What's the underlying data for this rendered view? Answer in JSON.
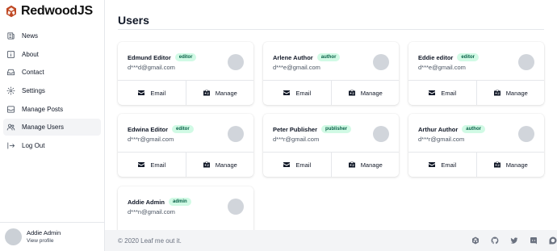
{
  "brand": {
    "name": "RedwoodJS",
    "accent": "#bf4722"
  },
  "sidebar": {
    "items": [
      {
        "label": "News",
        "icon": "newspaper-icon"
      },
      {
        "label": "About",
        "icon": "info-icon"
      },
      {
        "label": "Contact",
        "icon": "inbox-icon"
      },
      {
        "label": "Settings",
        "icon": "gear-icon"
      },
      {
        "label": "Manage Posts",
        "icon": "archive-icon"
      },
      {
        "label": "Manage Users",
        "icon": "users-icon",
        "active": true
      },
      {
        "label": "Log Out",
        "icon": "logout-icon"
      }
    ],
    "profile": {
      "name": "Addie Admin",
      "link": "View profile"
    }
  },
  "page": {
    "title": "Users"
  },
  "users": [
    {
      "name": "Edmund Editor",
      "role": "editor",
      "email": "d***d@gmail.com"
    },
    {
      "name": "Arlene Author",
      "role": "author",
      "email": "d***e@gmail.com"
    },
    {
      "name": "Eddie editor",
      "role": "editor",
      "email": "d***e@gmail.com"
    },
    {
      "name": "Edwina Editor",
      "role": "editor",
      "email": "d***r@gmail.com"
    },
    {
      "name": "Peter Publisher",
      "role": "publisher",
      "email": "d***r@gmail.com"
    },
    {
      "name": "Arthur Author",
      "role": "author",
      "email": "d***r@gmail.com"
    },
    {
      "name": "Addie Admin",
      "role": "admin",
      "email": "d***n@gmail.com"
    }
  ],
  "card_actions": {
    "email": "Email",
    "manage": "Manage"
  },
  "footer": {
    "copyright": "© 2020 Leaf me out it.",
    "social_icons": [
      "redwood-icon",
      "github-icon",
      "twitter-icon",
      "discord-icon",
      "discourse-icon"
    ]
  },
  "colors": {
    "badge_bg": "#d1fae5",
    "badge_text": "#065f46",
    "footer_bg": "#f3f4f6"
  }
}
